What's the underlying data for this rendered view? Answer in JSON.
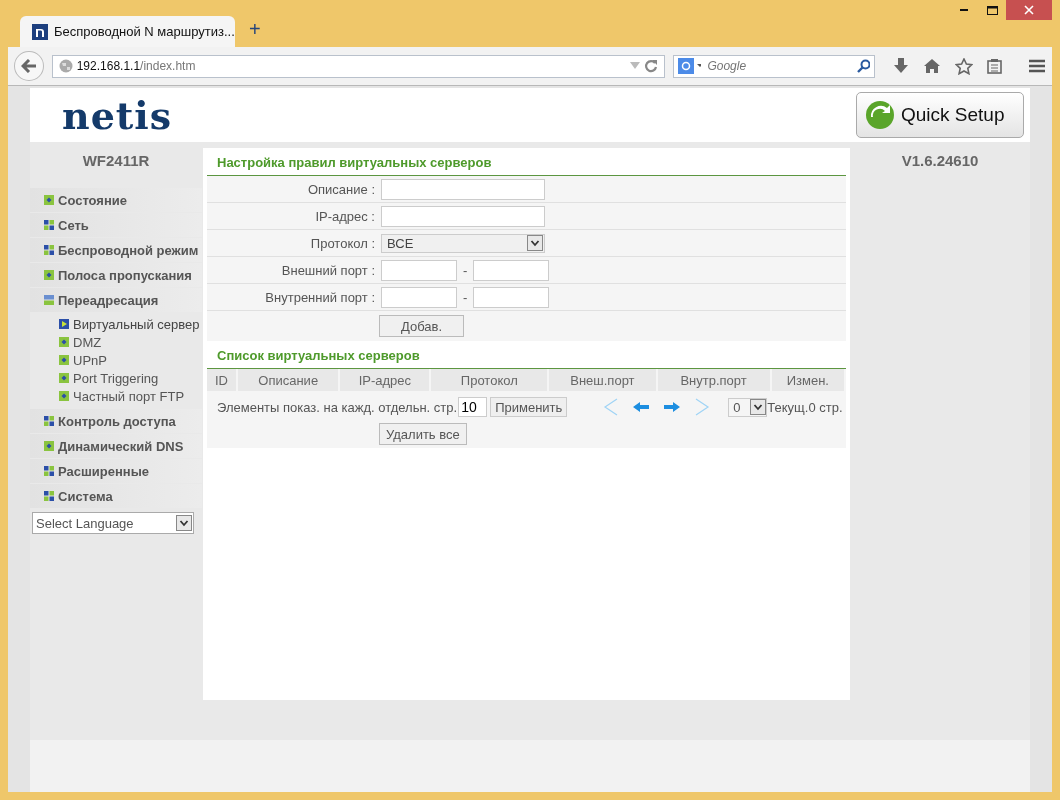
{
  "browser": {
    "tab_title": "Беспроводной N маршрутиз...",
    "new_tab": "+",
    "url_host": "192.168.1.1",
    "url_path": "/index.htm",
    "search_placeholder": "Google"
  },
  "header": {
    "logo": "netis",
    "quick_setup": "Quick Setup"
  },
  "sidebar": {
    "model": "WF2411R",
    "items": [
      {
        "label": "Состояние",
        "kind": "page"
      },
      {
        "label": "Сеть",
        "kind": "folder",
        "expanded": false
      },
      {
        "label": "Беспроводной режим",
        "kind": "folder",
        "expanded": false
      },
      {
        "label": "Полоса пропускания",
        "kind": "page"
      },
      {
        "label": "Переадресация",
        "kind": "folder",
        "expanded": true,
        "children": [
          {
            "label": "Виртуальный сервер",
            "selected": true
          },
          {
            "label": "DMZ",
            "selected": false
          },
          {
            "label": "UPnP",
            "selected": false
          },
          {
            "label": "Port Triggering",
            "selected": false
          },
          {
            "label": "Частный порт FTP",
            "selected": false
          }
        ]
      },
      {
        "label": "Контроль доступа",
        "kind": "folder",
        "expanded": false
      },
      {
        "label": "Динамический DNS",
        "kind": "page"
      },
      {
        "label": "Расширенные",
        "kind": "folder",
        "expanded": false
      },
      {
        "label": "Система",
        "kind": "folder",
        "expanded": false
      }
    ],
    "language": "Select Language"
  },
  "version": "V1.6.24610",
  "form": {
    "title": "Настройка правил виртуальных серверов",
    "rows": [
      {
        "label": "Описание :",
        "kind": "text"
      },
      {
        "label": "IP-адрес :",
        "kind": "text"
      },
      {
        "label": "Протокол :",
        "kind": "select",
        "value": "ВСЕ"
      },
      {
        "label": "Внешний порт :",
        "kind": "range",
        "separator": "-"
      },
      {
        "label": "Внутренний порт :",
        "kind": "range",
        "separator": "-"
      }
    ],
    "add_button": "Добав."
  },
  "list": {
    "title": "Список виртуальных серверов",
    "columns": [
      "ID",
      "Описание",
      "IP-адрес",
      "Протокол",
      "Внеш.порт",
      "Внутр.порт",
      "Измен."
    ],
    "per_page_label": "Элементы показ. на кажд. отдельн. стр.",
    "per_page": "10",
    "apply_button": "Применить",
    "page_value": "0",
    "current_page": "Текущ.0 стр.",
    "delete_all_button": "Удалить все"
  }
}
